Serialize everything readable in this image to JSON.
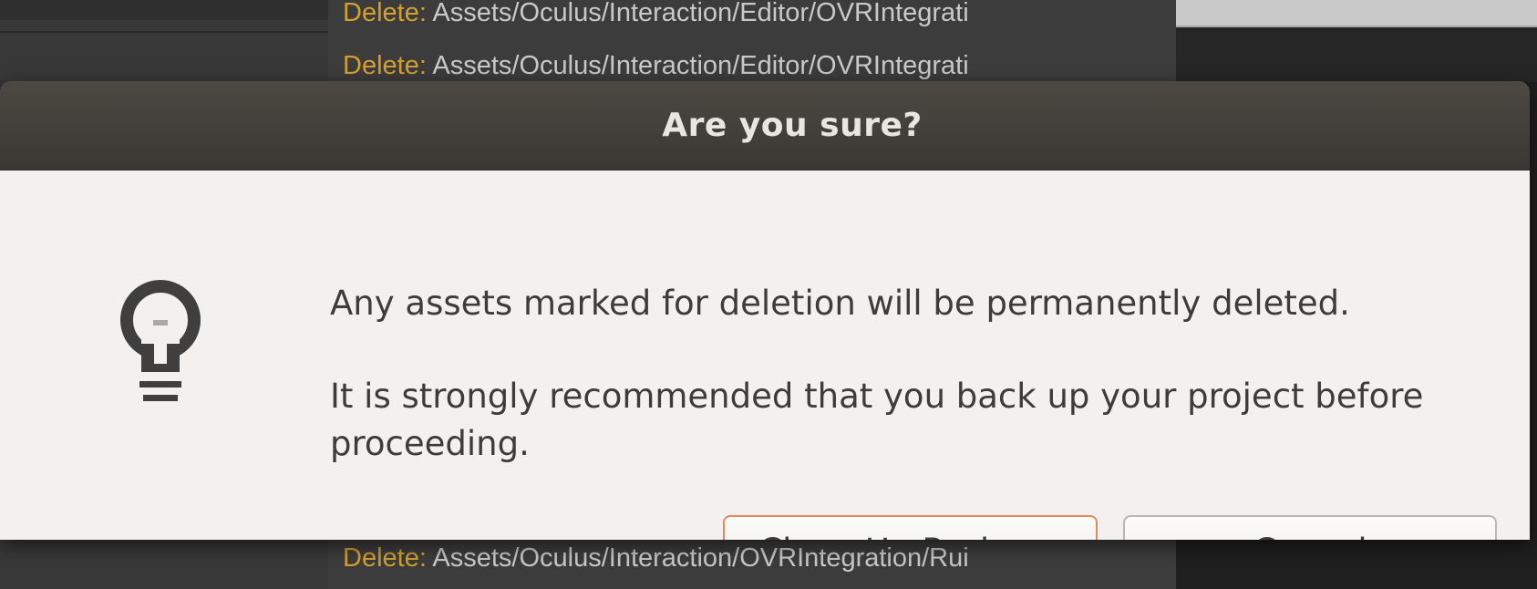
{
  "background": {
    "log_lines": [
      {
        "keyword": "Delete:",
        "path": "Assets/Oculus/Interaction/Editor/OVRIntegrati"
      },
      {
        "keyword": "Delete:",
        "path": "Assets/Oculus/Interaction/Editor/OVRIntegrati"
      },
      {
        "keyword": "Delete:",
        "path": "Assets/Oculus/Interaction/OVRIntegration/Rui"
      }
    ]
  },
  "dialog": {
    "title": "Are you sure?",
    "icon": "lightbulb-icon",
    "message_line1": "Any assets marked for deletion will be permanently deleted.",
    "message_line2": "It is strongly recommended that you back up your project before proceeding.",
    "buttons": {
      "primary_label": "Clean Up Package",
      "cancel_label": "Cancel"
    }
  },
  "colors": {
    "titlebar": "#46443e",
    "dialog_body": "#f2f1f0",
    "primary_button_border": "#e08a5e",
    "log_keyword": "#d4a030"
  }
}
